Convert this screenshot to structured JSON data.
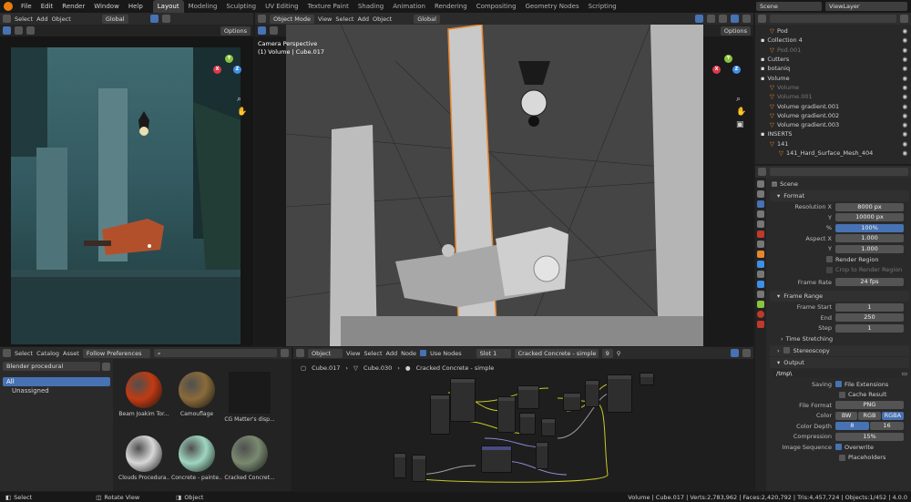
{
  "topbar": {
    "menus": [
      "File",
      "Edit",
      "Render",
      "Window",
      "Help"
    ],
    "workspaces": [
      "Layout",
      "Modeling",
      "Sculpting",
      "UV Editing",
      "Texture Paint",
      "Shading",
      "Animation",
      "Rendering",
      "Compositing",
      "Geometry Nodes",
      "Scripting"
    ],
    "active_workspace": "Layout",
    "scene": "Scene",
    "view_layer": "ViewLayer"
  },
  "left_viewport": {
    "menus": [
      "Select",
      "Add",
      "Object"
    ],
    "orientation": "Global",
    "options": "Options"
  },
  "main_viewport": {
    "mode": "Object Mode",
    "menus": [
      "View",
      "Select",
      "Add",
      "Object"
    ],
    "orientation": "Global",
    "options": "Options",
    "overlay_line1": "Camera Perspective",
    "overlay_line2": "(1) Volume | Cube.017"
  },
  "outliner": {
    "rows": [
      {
        "name": "Pod",
        "indent": 1,
        "dim": false
      },
      {
        "name": "Collection 4",
        "indent": 0,
        "dim": false
      },
      {
        "name": "Pod.001",
        "indent": 1,
        "dim": true
      },
      {
        "name": "Cutters",
        "indent": 0,
        "dim": false
      },
      {
        "name": "botaniq",
        "indent": 0,
        "dim": false
      },
      {
        "name": "Volume",
        "indent": 0,
        "dim": false
      },
      {
        "name": "Volume",
        "indent": 1,
        "dim": true
      },
      {
        "name": "Volume.001",
        "indent": 1,
        "dim": true
      },
      {
        "name": "Volume gradient.001",
        "indent": 1,
        "dim": false
      },
      {
        "name": "Volume gradient.002",
        "indent": 1,
        "dim": false
      },
      {
        "name": "Volume gradient.003",
        "indent": 1,
        "dim": false
      },
      {
        "name": "INSERTS",
        "indent": 0,
        "dim": false
      },
      {
        "name": "141",
        "indent": 1,
        "dim": false
      },
      {
        "name": "141_Hard_Surface_Mesh_404",
        "indent": 2,
        "dim": false
      }
    ]
  },
  "properties": {
    "breadcrumb": "Scene",
    "format_section": "Format",
    "resolution_x_label": "Resolution X",
    "resolution_x": "8000 px",
    "y_label": "Y",
    "resolution_y": "10000 px",
    "pct_label": "%",
    "resolution_pct": "100%",
    "aspect_x_label": "Aspect X",
    "aspect_x": "1.000",
    "aspect_y": "1.000",
    "render_region": "Render Region",
    "crop_region": "Crop to Render Region",
    "frame_rate_label": "Frame Rate",
    "frame_rate": "24 fps",
    "frame_range_section": "Frame Range",
    "frame_start_label": "Frame Start",
    "frame_start": "1",
    "end_label": "End",
    "frame_end": "250",
    "step_label": "Step",
    "frame_step": "1",
    "time_stretching": "Time Stretching",
    "stereoscopy": "Stereoscopy",
    "output_section": "Output",
    "output_path": "/tmp\\",
    "saving_label": "Saving",
    "file_extensions": "File Extensions",
    "cache_result": "Cache Result",
    "file_format_label": "File Format",
    "file_format": "PNG",
    "color_label": "Color",
    "color_opts": [
      "BW",
      "RGB",
      "RGBA"
    ],
    "color_depth_label": "Color Depth",
    "depth_opts": [
      "8",
      "16"
    ],
    "compression_label": "Compression",
    "compression": "15%",
    "image_sequence_label": "Image Sequence",
    "overwrite": "Overwrite",
    "placeholders": "Placeholders"
  },
  "asset_browser": {
    "menus": [
      "Select",
      "Catalog",
      "Asset"
    ],
    "preference": "Follow Preferences",
    "library": "Blender procedural",
    "catalogs": [
      "All",
      "Unassigned"
    ],
    "assets": [
      {
        "name": "Beam Joakim Tor...",
        "color": "#c23a12"
      },
      {
        "name": "Camouflage",
        "color": "#8a6b3a"
      },
      {
        "name": "CG Matter's disp...",
        "color": "#1a1a1a"
      },
      {
        "name": "Clouds Procedura...",
        "color": "#d8d8d8"
      },
      {
        "name": "Concrete - painte...",
        "color": "#9fd6c0"
      },
      {
        "name": "Cracked Concret...",
        "color": "#7a8a70"
      }
    ]
  },
  "node_editor": {
    "type": "Object",
    "menus": [
      "View",
      "Select",
      "Add",
      "Node"
    ],
    "use_nodes": "Use Nodes",
    "slot": "Slot 1",
    "material": "Cracked Concrete - simple",
    "users": "9",
    "breadcrumb": [
      "Cube.017",
      "Cube.030",
      "Cracked Concrete - simple"
    ]
  },
  "statusbar": {
    "select": "Select",
    "rotate": "Rotate View",
    "object": "Object",
    "stats": "Volume | Cube.017 | Verts:2,783,962 | Faces:2,420,792 | Tris:4,457,724 | Objects:1/452 | 4.0.0"
  },
  "colors": {
    "accent": "#4772b3",
    "selection_orange": "#e8862c",
    "background": "#1d1d1d"
  }
}
